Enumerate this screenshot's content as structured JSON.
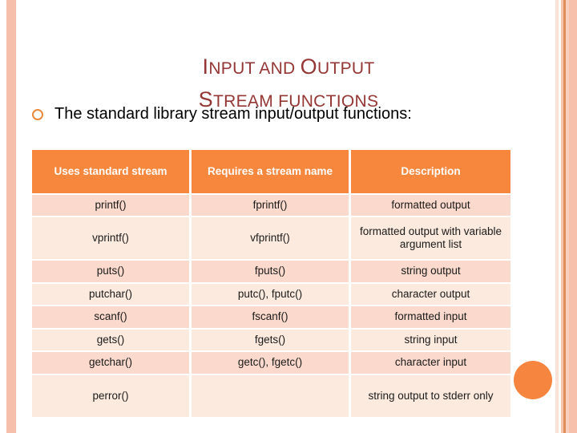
{
  "slide": {
    "title_line1_lead": "I",
    "title_line1_a": "NPUT AND ",
    "title_line1_lead2": "O",
    "title_line1_b": "UTPUT",
    "title_line2_lead": "S",
    "title_line2_rest": "TREAM FUNCTIONS",
    "title_full": "INPUT AND OUTPUT STREAM FUNCTIONS",
    "bullet_text": "The standard library stream input/output functions:",
    "colors": {
      "title": "#943634",
      "header_bg": "#f7873c",
      "row_odd": "#fbd9cc",
      "row_even": "#fdeade",
      "bullet": "#e8883d",
      "accent_circle": "#f5853f",
      "stripe": "#f5bfac"
    }
  },
  "table": {
    "headers": [
      "Uses standard stream",
      "Requires a stream name",
      "Description"
    ],
    "rows": [
      {
        "standard": "printf()",
        "stream": "fprintf()",
        "description": "formatted output"
      },
      {
        "standard": "vprintf()",
        "stream": "vfprintf()",
        "description": "formatted output with variable argument list"
      },
      {
        "standard": "puts()",
        "stream": "fputs()",
        "description": "string output"
      },
      {
        "standard": "putchar()",
        "stream": "putc(), fputc()",
        "description": "character output"
      },
      {
        "standard": "scanf()",
        "stream": "fscanf()",
        "description": "formatted input"
      },
      {
        "standard": "gets()",
        "stream": "fgets()",
        "description": "string input"
      },
      {
        "standard": "getchar()",
        "stream": "getc(), fgetc()",
        "description": "character input"
      },
      {
        "standard": "perror()",
        "stream": "",
        "description": "string output to stderr only"
      }
    ]
  }
}
